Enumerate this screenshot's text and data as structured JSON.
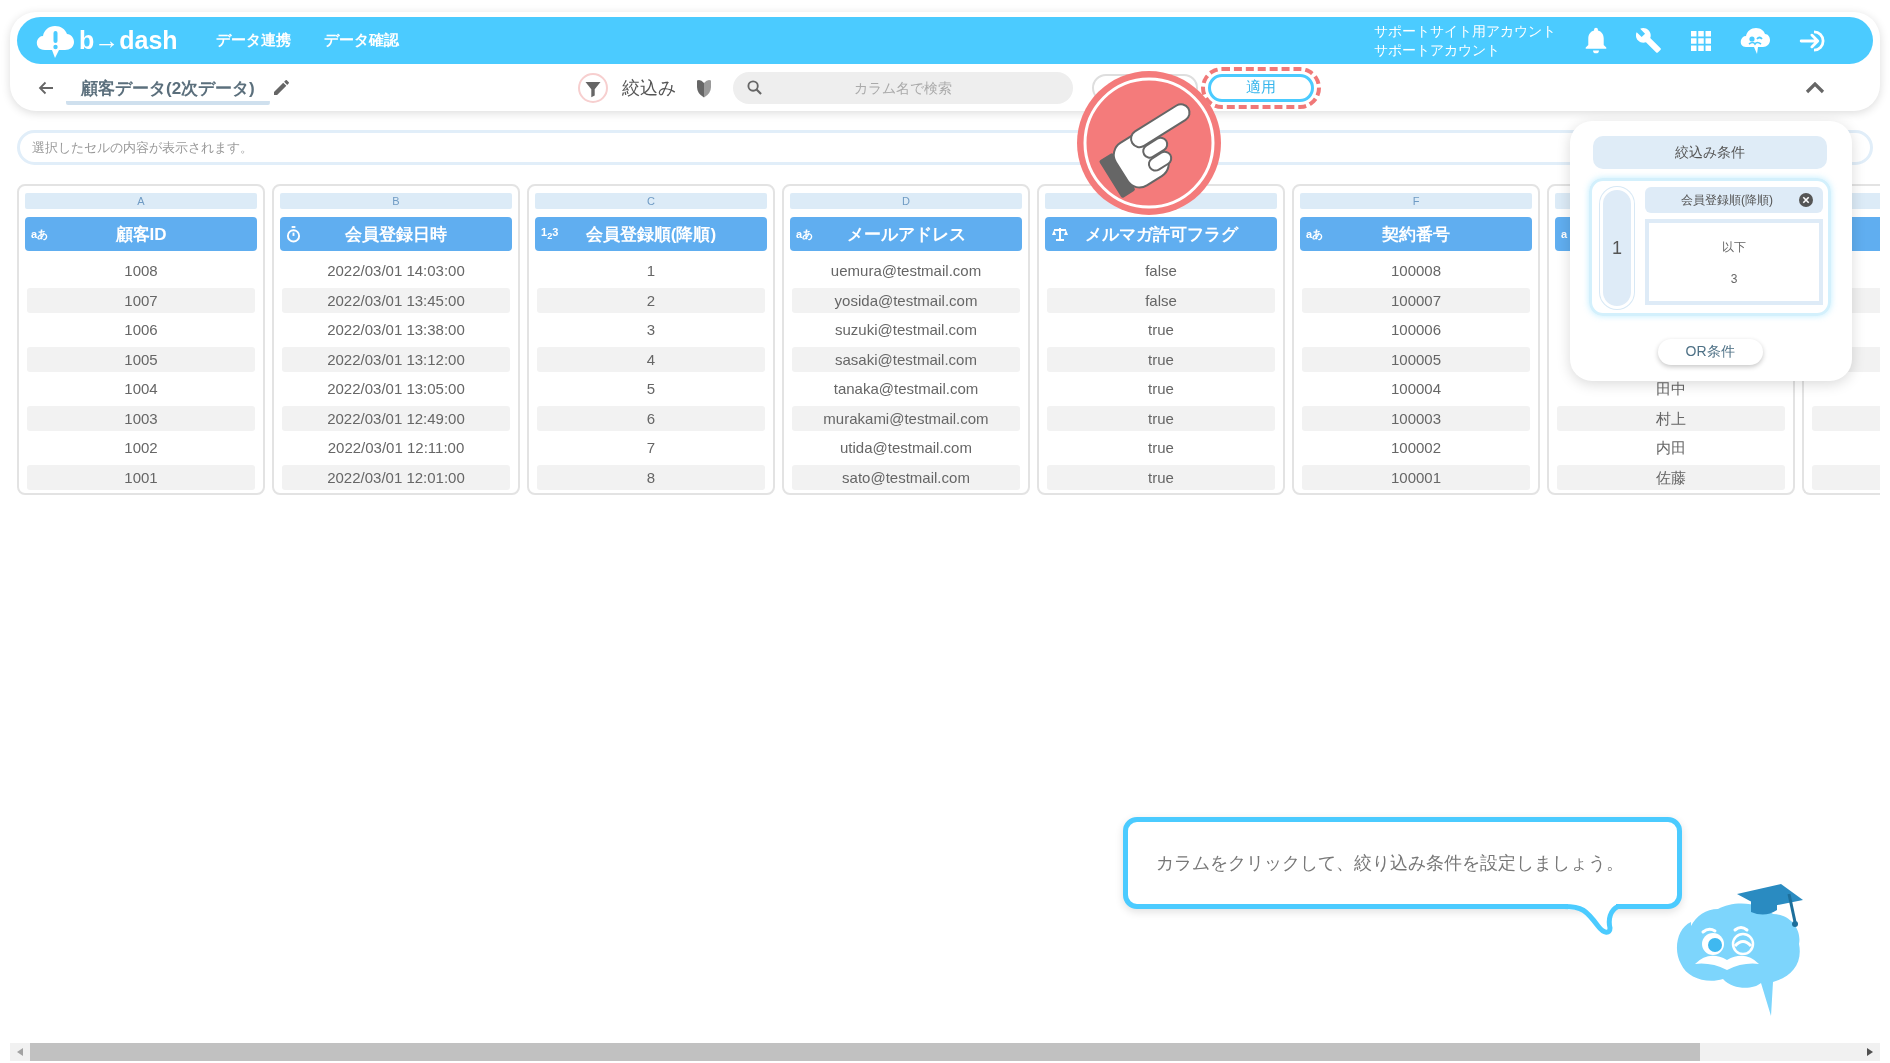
{
  "header": {
    "logo": "b→dash",
    "nav": [
      {
        "label": "データ連携"
      },
      {
        "label": "データ確認"
      }
    ],
    "account": {
      "site": "サポートサイト用アカウント",
      "name": "サポートアカウント"
    }
  },
  "toolbar": {
    "title": "顧客データ(2次データ)",
    "filter_label": "絞込み",
    "search": {
      "placeholder": "カラム名で検索"
    },
    "apply_button": {
      "label": "適用",
      "highlighted": true
    }
  },
  "cell_viewer": {
    "placeholder": "選択したセルの内容が表示されます。"
  },
  "table": {
    "columns": [
      {
        "letter": "A",
        "name": "顧客ID",
        "kind": "text",
        "type_label": "aあ",
        "cells": [
          "1008",
          "1007",
          "1006",
          "1005",
          "1004",
          "1003",
          "1002",
          "1001"
        ]
      },
      {
        "letter": "B",
        "name": "会員登録日時",
        "kind": "datetime",
        "cells": [
          "2022/03/01 14:03:00",
          "2022/03/01 13:45:00",
          "2022/03/01 13:38:00",
          "2022/03/01 13:12:00",
          "2022/03/01 13:05:00",
          "2022/03/01 12:49:00",
          "2022/03/01 12:11:00",
          "2022/03/01 12:01:00"
        ]
      },
      {
        "letter": "C",
        "name": "会員登録順(降順)",
        "kind": "number",
        "type_label": "1$_{2}$3",
        "cells": [
          "1",
          "2",
          "3",
          "4",
          "5",
          "6",
          "7",
          "8"
        ]
      },
      {
        "letter": "D",
        "name": "メールアドレス",
        "kind": "text",
        "type_label": "aあ",
        "cells": [
          "uemura@testmail.com",
          "yosida@testmail.com",
          "suzuki@testmail.com",
          "sasaki@testmail.com",
          "tanaka@testmail.com",
          "murakami@testmail.com",
          "utida@testmail.com",
          "sato@testmail.com"
        ]
      },
      {
        "name": "メルマガ許可フラグ",
        "kind": "boolean",
        "cells": [
          "false",
          "false",
          "true",
          "true",
          "true",
          "true",
          "true",
          "true"
        ]
      },
      {
        "letter": "F",
        "name": "契約番号",
        "kind": "text",
        "type_label": "aあ",
        "cells": [
          "100008",
          "100007",
          "100006",
          "100005",
          "100004",
          "100003",
          "100002",
          "100001"
        ]
      },
      {
        "kind": "text",
        "type_label": "a",
        "cells": [
          "田中",
          "村上",
          "内田",
          "佐藤"
        ]
      }
    ]
  },
  "filter_panel": {
    "title": "絞込み条件",
    "groups": [
      {
        "number": "1",
        "conditions": [
          {
            "column": "会員登録順(降順)",
            "operator": "以下",
            "value": "3"
          }
        ]
      }
    ],
    "or_button": "OR条件"
  },
  "tutorial": {
    "message": "カラムをクリックして、絞り込み条件を設定しましょう。"
  }
}
